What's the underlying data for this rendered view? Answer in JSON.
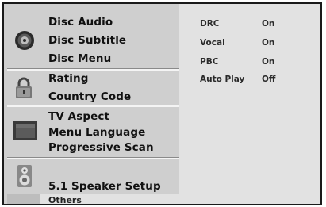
{
  "menu": {
    "groups": [
      {
        "icon": "disc-icon",
        "items": [
          "Disc Audio",
          "Disc Subtitle",
          "Disc Menu"
        ]
      },
      {
        "icon": "lock-icon",
        "items": [
          "Rating",
          "Country Code"
        ]
      },
      {
        "icon": "tv-screen-icon",
        "items": [
          "TV Aspect",
          "Menu Language",
          "Progressive Scan"
        ]
      },
      {
        "icon": "speaker-icon",
        "items": [
          "5.1 Speaker Setup"
        ]
      }
    ],
    "others_label": "Others"
  },
  "settings": [
    {
      "name": "DRC",
      "value": "On"
    },
    {
      "name": "Vocal",
      "value": "On"
    },
    {
      "name": "PBC",
      "value": "On"
    },
    {
      "name": "Auto Play",
      "value": "Off"
    }
  ]
}
